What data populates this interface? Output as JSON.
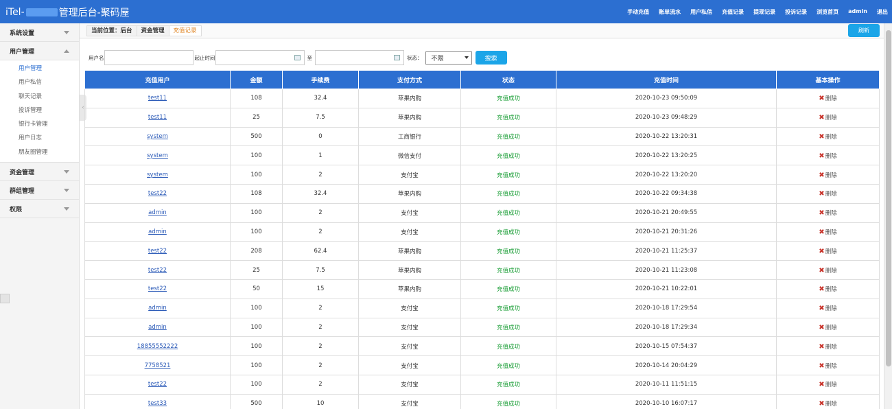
{
  "app": {
    "title_prefix": "iTel-",
    "title_suffix": "管理后台-聚码屋"
  },
  "top_nav": [
    "手动充值",
    "账单流水",
    "用户私信",
    "充值记录",
    "提现记录",
    "投诉记录",
    "浏览首页",
    "admin",
    "退出"
  ],
  "sidebar": {
    "groups": [
      {
        "label": "系统设置",
        "expanded": false
      },
      {
        "label": "用户管理",
        "expanded": true,
        "items": [
          "用户管理",
          "用户私信",
          "聊天记录",
          "投诉管理",
          "银行卡管理",
          "用户日志",
          "朋友圈管理"
        ]
      },
      {
        "label": "资金管理",
        "expanded": false
      },
      {
        "label": "群组管理",
        "expanded": false
      },
      {
        "label": "权限",
        "expanded": false
      }
    ]
  },
  "breadcrumb": {
    "prefix": "当前位置：后台",
    "section": "资金管理",
    "current": "充值记录"
  },
  "refresh_label": "刷新",
  "filter": {
    "username_label": "用户名",
    "start_label": "起止时间",
    "to_label": "至",
    "status_label": "状态：",
    "status_value": "不限",
    "search_label": "搜索"
  },
  "table": {
    "headers": [
      "充值用户",
      "金额",
      "手续费",
      "支付方式",
      "状态",
      "充值时间",
      "基本操作"
    ],
    "delete_label": "删除",
    "rows": [
      {
        "user": "test11",
        "amount": "108",
        "fee": "32.4",
        "method": "苹果内购",
        "status": "充值成功",
        "time": "2020-10-23 09:50:09"
      },
      {
        "user": "test11",
        "amount": "25",
        "fee": "7.5",
        "method": "苹果内购",
        "status": "充值成功",
        "time": "2020-10-23 09:48:29"
      },
      {
        "user": "system",
        "amount": "500",
        "fee": "0",
        "method": "工商银行",
        "status": "充值成功",
        "time": "2020-10-22 13:20:31"
      },
      {
        "user": "system",
        "amount": "100",
        "fee": "1",
        "method": "微信支付",
        "status": "充值成功",
        "time": "2020-10-22 13:20:25"
      },
      {
        "user": "system",
        "amount": "100",
        "fee": "2",
        "method": "支付宝",
        "status": "充值成功",
        "time": "2020-10-22 13:20:20"
      },
      {
        "user": "test22",
        "amount": "108",
        "fee": "32.4",
        "method": "苹果内购",
        "status": "充值成功",
        "time": "2020-10-22 09:34:38"
      },
      {
        "user": "admin",
        "amount": "100",
        "fee": "2",
        "method": "支付宝",
        "status": "充值成功",
        "time": "2020-10-21 20:49:55"
      },
      {
        "user": "admin",
        "amount": "100",
        "fee": "2",
        "method": "支付宝",
        "status": "充值成功",
        "time": "2020-10-21 20:31:26"
      },
      {
        "user": "test22",
        "amount": "208",
        "fee": "62.4",
        "method": "苹果内购",
        "status": "充值成功",
        "time": "2020-10-21 11:25:37"
      },
      {
        "user": "test22",
        "amount": "25",
        "fee": "7.5",
        "method": "苹果内购",
        "status": "充值成功",
        "time": "2020-10-21 11:23:08"
      },
      {
        "user": "test22",
        "amount": "50",
        "fee": "15",
        "method": "苹果内购",
        "status": "充值成功",
        "time": "2020-10-21 10:22:01"
      },
      {
        "user": "admin",
        "amount": "100",
        "fee": "2",
        "method": "支付宝",
        "status": "充值成功",
        "time": "2020-10-18 17:29:54"
      },
      {
        "user": "admin",
        "amount": "100",
        "fee": "2",
        "method": "支付宝",
        "status": "充值成功",
        "time": "2020-10-18 17:29:34"
      },
      {
        "user": "18855552222",
        "amount": "100",
        "fee": "2",
        "method": "支付宝",
        "status": "充值成功",
        "time": "2020-10-15 07:54:37"
      },
      {
        "user": "7758521",
        "amount": "100",
        "fee": "2",
        "method": "支付宝",
        "status": "充值成功",
        "time": "2020-10-14 20:04:29"
      },
      {
        "user": "test22",
        "amount": "100",
        "fee": "2",
        "method": "支付宝",
        "status": "充值成功",
        "time": "2020-10-11 11:51:15"
      },
      {
        "user": "test33",
        "amount": "500",
        "fee": "10",
        "method": "支付宝",
        "status": "充值成功",
        "time": "2020-10-10 16:07:17"
      }
    ]
  },
  "colors": {
    "primary": "#2c6fd1",
    "button": "#1ba5e8",
    "success": "#1a9e36",
    "delete_x": "#c8342b",
    "breadcrumb_current": "#e0892b"
  }
}
